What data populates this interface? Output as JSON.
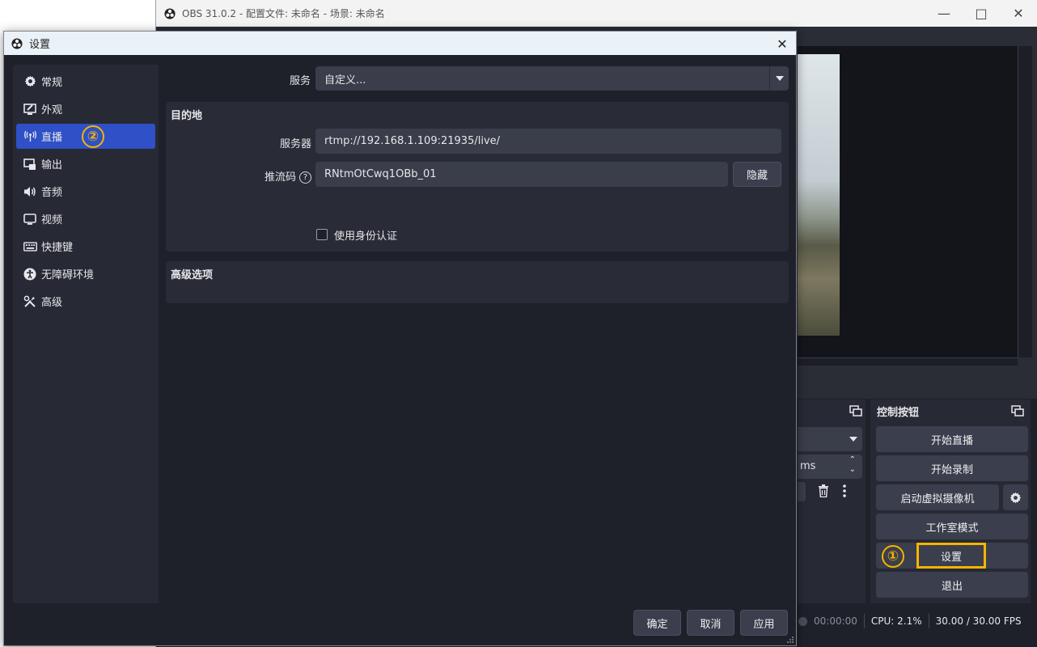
{
  "main_window": {
    "title": "OBS 31.0.2 - 配置文件: 未命名 - 场景: 未命名",
    "window_controls": [
      "minimize",
      "maximize",
      "close"
    ],
    "controls_dock": {
      "title": "控制按钮",
      "buttons": {
        "start_stream": "开始直播",
        "start_record": "开始录制",
        "virtual_camera": "启动虚拟摄像机",
        "studio_mode": "工作室模式",
        "settings": "设置",
        "exit": "退出"
      },
      "settings_marker": "①"
    },
    "mid_dock": {
      "ms_suffix": "ms"
    },
    "status_bar": {
      "time": "00:00:00",
      "cpu": "CPU: 2.1%",
      "fps": "30.00 / 30.00 FPS"
    }
  },
  "settings_dialog": {
    "title": "设置",
    "sidebar": {
      "items": [
        {
          "label": "常规",
          "icon": "gear-icon"
        },
        {
          "label": "外观",
          "icon": "appearance-icon"
        },
        {
          "label": "直播",
          "icon": "antenna-icon"
        },
        {
          "label": "输出",
          "icon": "output-icon"
        },
        {
          "label": "音频",
          "icon": "speaker-icon"
        },
        {
          "label": "视频",
          "icon": "monitor-icon"
        },
        {
          "label": "快捷键",
          "icon": "keyboard-icon"
        },
        {
          "label": "无障碍环境",
          "icon": "accessibility-icon"
        },
        {
          "label": "高级",
          "icon": "tools-icon"
        }
      ],
      "active_index": 2,
      "active_marker": "②"
    },
    "stream": {
      "service_label": "服务",
      "service_value": "自定义...",
      "destination_title": "目的地",
      "server_label": "服务器",
      "server_value": "rtmp://192.168.1.109:21935/live/",
      "stream_key_label": "推流码",
      "stream_key_value": "RNtmOtCwq1OBb_01",
      "hide_button": "隐藏",
      "auth_checkbox_label": "使用身份认证",
      "auth_checked": false,
      "advanced_title": "高级选项"
    },
    "footer": {
      "ok": "确定",
      "cancel": "取消",
      "apply": "应用"
    }
  },
  "colors": {
    "accent_active": "#2f50c7",
    "highlight_annotation": "#f4b400",
    "window_bg": "#1f212a",
    "panel_bg": "#272934"
  }
}
